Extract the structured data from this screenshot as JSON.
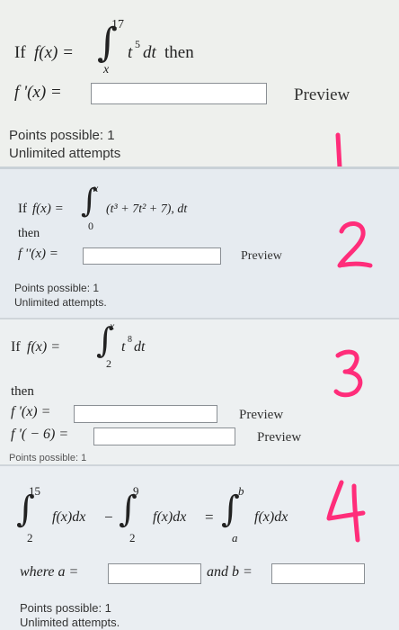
{
  "problem1": {
    "if_text": "If",
    "f_of_x": "f(x) =",
    "upper_limit": "17",
    "lower_limit": "x",
    "integrand_base": "t",
    "integrand_exp": "5",
    "dt": "dt",
    "then_text": "then",
    "answer_label": "f '(x) =",
    "answer_value": "",
    "preview_label": "Preview",
    "points_text": "Points possible: 1",
    "attempts_text": "Unlimited attempts",
    "annotation": "1"
  },
  "problem2": {
    "if_text": "If",
    "f_of_x": "f(x) =",
    "upper_limit": "x",
    "lower_limit": "0",
    "integrand": "(t³ + 7t² + 7), dt",
    "then_text": "then",
    "answer_label": "f ''(x) =",
    "answer_value": "",
    "preview_label": "Preview",
    "points_text": "Points possible: 1",
    "attempts_text": "Unlimited attempts.",
    "annotation": "2"
  },
  "problem3": {
    "if_text": "If",
    "f_of_x": "f(x) =",
    "upper_limit": "x",
    "lower_limit": "2",
    "integrand_base": "t",
    "integrand_exp": "8",
    "dt": "dt",
    "then_text": "then",
    "answer1_label": "f '(x) =",
    "answer1_value": "",
    "answer2_label": "f '( − 6) =",
    "answer2_value": "",
    "preview_label": "Preview",
    "points_text": "Points possible: 1",
    "annotation": "3"
  },
  "problem4": {
    "int1_upper": "15",
    "int1_lower": "2",
    "int2_upper": "9",
    "int2_lower": "2",
    "int3_upper": "b",
    "int3_lower": "a",
    "fx_dx": "f(x)dx",
    "minus": "−",
    "equals": "=",
    "where_a_label": "where a =",
    "a_value": "",
    "and_b_label": "and b =",
    "b_value": "",
    "points_text": "Points possible: 1",
    "attempts_text": "Unlimited attempts.",
    "annotation": "4"
  },
  "colors": {
    "annotation": "#ff2d7a",
    "input_border": "#8a8f94"
  }
}
